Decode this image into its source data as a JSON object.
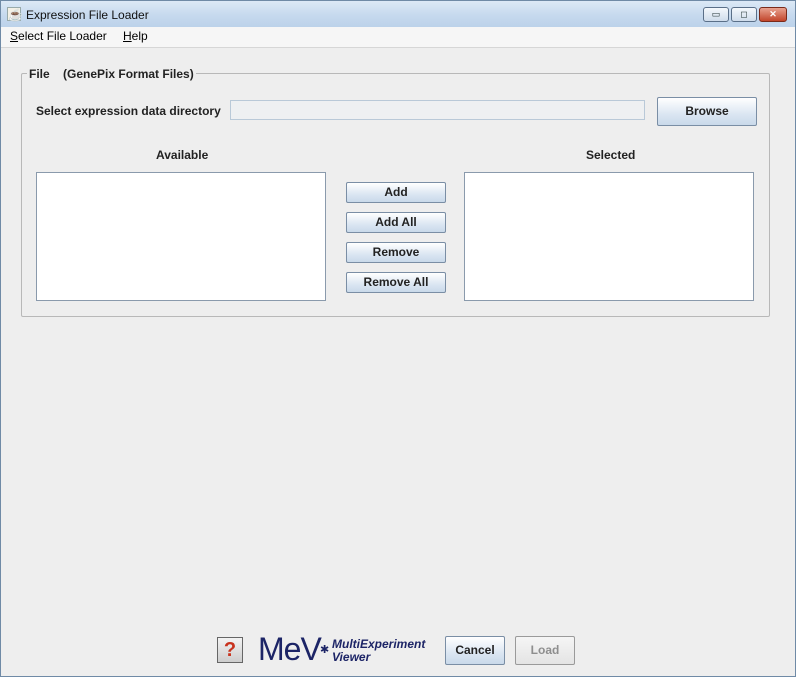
{
  "window": {
    "title": "Expression File Loader",
    "icon": "java-cup-icon"
  },
  "title_buttons": {
    "minimize": "▭",
    "maximize": "◻",
    "close": "✕"
  },
  "menu": {
    "items": [
      {
        "mnemonic": "S",
        "rest": "elect File Loader"
      },
      {
        "mnemonic": "H",
        "rest": "elp"
      }
    ]
  },
  "file_group": {
    "title": "File    (GenePix Format Files)",
    "dir_label": "Select expression data directory",
    "dir_value": "",
    "browse_label": "Browse",
    "available_label": "Available",
    "selected_label": "Selected",
    "available_items": [],
    "selected_items": [],
    "buttons": {
      "add": "Add",
      "add_all": "Add All",
      "remove": "Remove",
      "remove_all": "Remove All"
    }
  },
  "footer": {
    "help_glyph": "?",
    "logo_text": "MeV",
    "logo_star": "✱",
    "logo_sub1": "MultiExperiment",
    "logo_sub2": "Viewer",
    "cancel_label": "Cancel",
    "load_label": "Load"
  }
}
